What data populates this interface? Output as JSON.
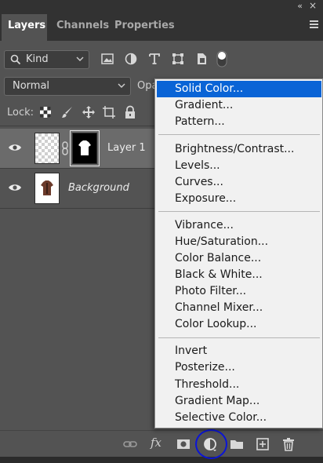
{
  "window": {
    "collapse_glyph": "«",
    "close_glyph": "×"
  },
  "tabs": [
    {
      "label": "Layers",
      "active": true
    },
    {
      "label": "Channels",
      "active": false
    },
    {
      "label": "Properties",
      "active": false
    }
  ],
  "filter": {
    "kind_label": "Kind",
    "icons": [
      "image-filter-icon",
      "adjustment-filter-icon",
      "type-filter-icon",
      "shape-filter-icon",
      "smart-object-filter-icon",
      "filter-toggle-icon"
    ]
  },
  "blend": {
    "mode": "Normal",
    "opacity_label": "Opa"
  },
  "lock": {
    "label": "Lock:",
    "icons": [
      "lock-transparent-pixels-icon",
      "lock-image-pixels-icon",
      "lock-position-icon",
      "lock-artboard-icon",
      "lock-all-icon"
    ]
  },
  "layers": [
    {
      "name": "Layer 1",
      "selected": true,
      "italic": false
    },
    {
      "name": "Background",
      "selected": false,
      "italic": true
    }
  ],
  "adjustment_menu": {
    "groups": [
      [
        "Solid Color...",
        "Gradient...",
        "Pattern..."
      ],
      [
        "Brightness/Contrast...",
        "Levels...",
        "Curves...",
        "Exposure..."
      ],
      [
        "Vibrance...",
        "Hue/Saturation...",
        "Color Balance...",
        "Black & White...",
        "Photo Filter...",
        "Channel Mixer...",
        "Color Lookup..."
      ],
      [
        "Invert",
        "Posterize...",
        "Threshold...",
        "Gradient Map...",
        "Selective Color..."
      ]
    ],
    "selected": "Solid Color..."
  },
  "bottom": {
    "fx_label": "fx",
    "icons": [
      "link-layers-icon",
      "add-layer-style-icon",
      "add-mask-icon",
      "new-adjustment-layer-icon",
      "new-group-icon",
      "new-layer-icon",
      "delete-layer-icon"
    ]
  },
  "colors": {
    "panel_bg": "#535353",
    "selected_layer": "#6b6b6b",
    "menu_highlight": "#0a64d6",
    "annotation_ring": "#0a14d8"
  }
}
